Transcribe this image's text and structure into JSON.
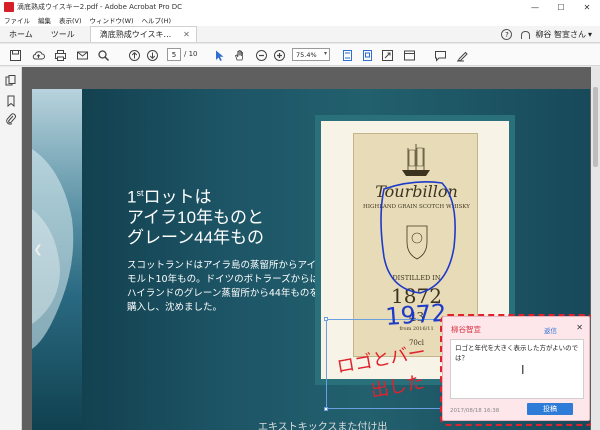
{
  "titlebar": {
    "title": "滴底熟成ウイスキー2.pdf - Adobe Acrobat Pro DC",
    "minimize": "—",
    "maximize": "☐",
    "close": "✕"
  },
  "menu": [
    "ファイル",
    "編集",
    "表示(V)",
    "ウィンドウ(W)",
    "ヘルプ(H)"
  ],
  "tabs": {
    "home": "ホーム",
    "tools": "ツール",
    "doc": "滴底熟成ウイスキ...",
    "doc_close": "✕"
  },
  "user": {
    "help": "?",
    "name": "柳谷 智宣さん",
    "dropdown": "▾"
  },
  "toolbar": {
    "page_current": "5",
    "page_total": "/ 10",
    "zoom": "75.4%"
  },
  "page": {
    "headline_pre": "1",
    "headline_sup": "st",
    "headline_l1": "ロットは",
    "headline_l2": "アイラ10年ものと",
    "headline_l3": "グレーン44年もの",
    "body": "スコットランドはアイラ島の蒸留所からアイラモルト10年もの。ドイツのボトラーズからはハイランドのグレーン蒸留所から44年ものを購入し、沈めました。"
  },
  "label": {
    "logo": "Tourbillon",
    "subtitle": "HIGHLAND GRAIN SCOTCH WHISKY",
    "distilled": "DISTILLED IN",
    "year": "1872",
    "age": "43",
    "bottled": "from 2016/11",
    "volume": "70cl"
  },
  "ink": {
    "year": "1972",
    "note_l1": "ロゴとバー",
    "note_l2": "出した"
  },
  "comment": {
    "author": "柳谷智宣",
    "reply": "返信",
    "close": "✕",
    "text": "ロゴと年代を大きく表示した方がよいのでは？",
    "time": "2017/08/18 16:38",
    "post": "投稿"
  },
  "bottom": "エキストキックスまた付け出",
  "colors": {
    "accent": "#2f7bd8",
    "comment_bg": "#fde7ea",
    "ink_blue": "#1f3ac9",
    "ink_red": "#e0222e"
  }
}
